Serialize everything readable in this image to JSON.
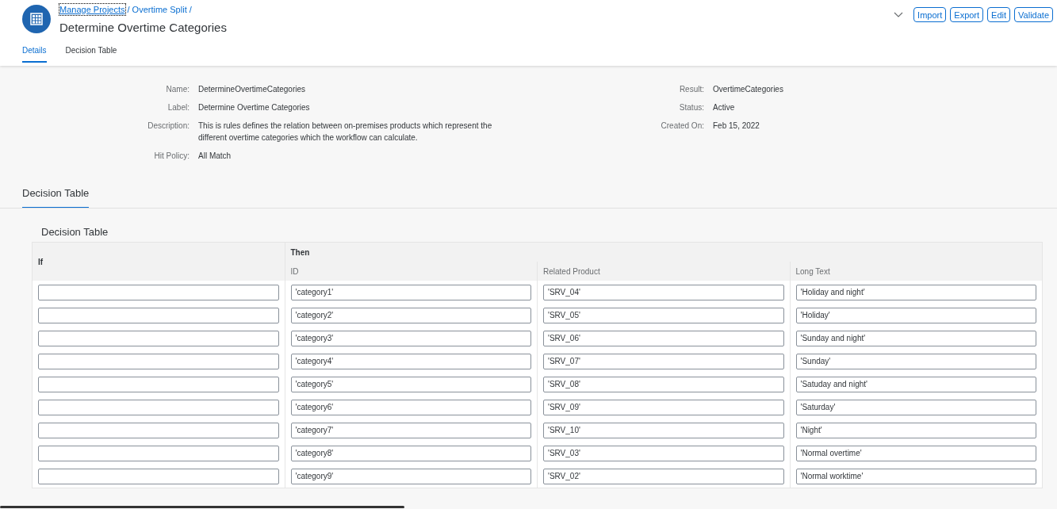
{
  "header": {
    "breadcrumbs": [
      {
        "label": "Manage Projects",
        "separator": "/",
        "focused": true
      },
      {
        "label": "Overtime Split",
        "separator": "/",
        "focused": false
      }
    ],
    "title": "Determine Overtime Categories",
    "actions": [
      "Import",
      "Export",
      "Edit",
      "Validate"
    ]
  },
  "tabs": [
    {
      "label": "Details",
      "selected": true
    },
    {
      "label": "Decision Table",
      "selected": false
    }
  ],
  "details": {
    "left": [
      {
        "label": "Name:",
        "value": "DetermineOvertimeCategories"
      },
      {
        "label": "Label:",
        "value": "Determine Overtime Categories"
      },
      {
        "label": "Description:",
        "value": "This is rules defines the relation between on-premises products which represent the different overtime categories which the workflow can calculate."
      },
      {
        "label": "Hit Policy:",
        "value": "All Match"
      }
    ],
    "right": [
      {
        "label": "Result:",
        "value": "OvertimeCategories"
      },
      {
        "label": "Status:",
        "value": "Active"
      },
      {
        "label": "Created On:",
        "value": "Feb 15, 2022"
      }
    ]
  },
  "section": {
    "title": "Decision Table"
  },
  "table": {
    "title": "Decision Table",
    "groups": [
      "If",
      "Then"
    ],
    "columns": [
      "ID",
      "Related Product",
      "Long Text"
    ],
    "rows": [
      {
        "cells": [
          "'category1'",
          "'SRV_04'",
          "'Holiday and night'"
        ]
      },
      {
        "cells": [
          "'category2'",
          "'SRV_05'",
          "'Holiday'"
        ]
      },
      {
        "cells": [
          "'category3'",
          "'SRV_06'",
          "'Sunday and night'"
        ]
      },
      {
        "cells": [
          "'category4'",
          "'SRV_07'",
          "'Sunday'"
        ]
      },
      {
        "cells": [
          "'category5'",
          "'SRV_08'",
          "'Satuday and night'"
        ]
      },
      {
        "cells": [
          "'category6'",
          "'SRV_09'",
          "'Saturday'"
        ]
      },
      {
        "cells": [
          "'category7'",
          "'SRV_10'",
          "'Night'"
        ]
      },
      {
        "cells": [
          "'category8'",
          "'SRV_03'",
          "'Normal overtime'"
        ]
      },
      {
        "cells": [
          "'category9'",
          "'SRV_02'",
          "'Normal worktime'"
        ]
      }
    ]
  }
}
